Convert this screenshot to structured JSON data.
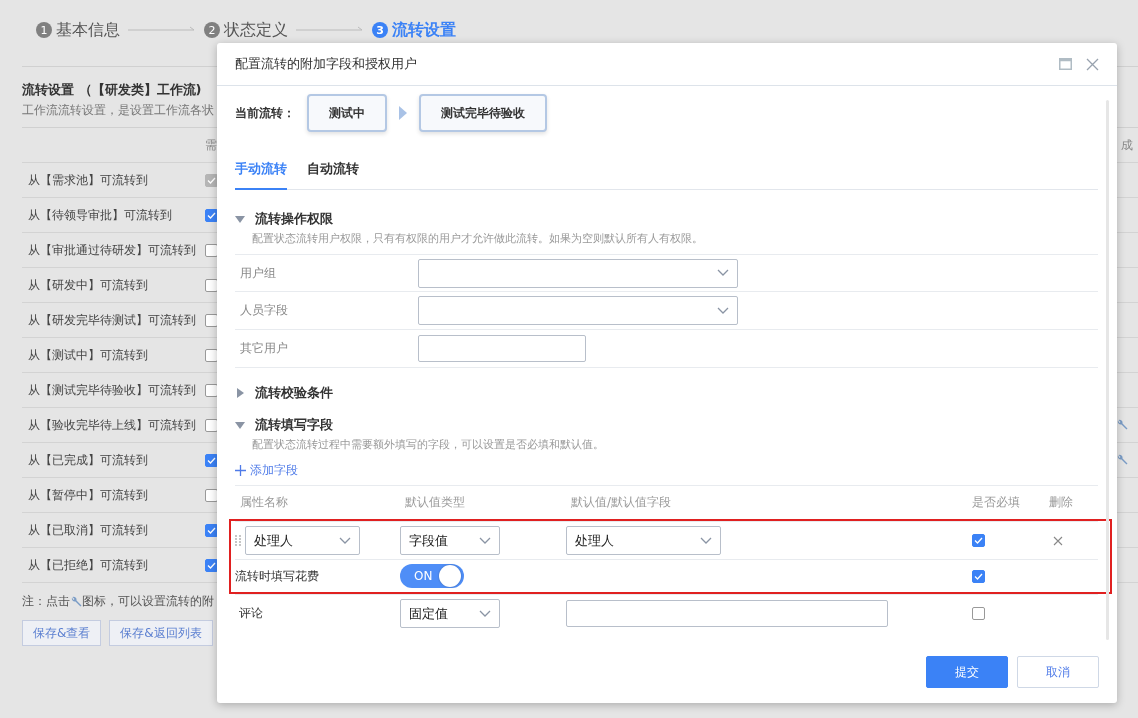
{
  "steps": [
    {
      "number": "1",
      "label": "基本信息",
      "selected": false
    },
    {
      "number": "2",
      "label": "状态定义",
      "selected": false
    },
    {
      "number": "3",
      "label": "流转设置",
      "selected": true
    }
  ],
  "page": {
    "title": "流转设置 （【研发类】工作流)",
    "description": "工作流流转设置，是设置工作流各状",
    "header_cells": [
      "需",
      "成"
    ],
    "rows": [
      {
        "label": "从【需求池】可流转到",
        "checked": true,
        "disabled": true,
        "tool": false
      },
      {
        "label": "从【待领导审批】可流转到",
        "checked": true,
        "disabled": false,
        "tool": false
      },
      {
        "label": "从【审批通过待研发】可流转到",
        "checked": false,
        "disabled": false,
        "tool": false
      },
      {
        "label": "从【研发中】可流转到",
        "checked": false,
        "disabled": false,
        "tool": false
      },
      {
        "label": "从【研发完毕待测试】可流转到",
        "checked": false,
        "disabled": false,
        "tool": false
      },
      {
        "label": "从【测试中】可流转到",
        "checked": false,
        "disabled": false,
        "tool": false
      },
      {
        "label": "从【测试完毕待验收】可流转到",
        "checked": false,
        "disabled": false,
        "tool": false
      },
      {
        "label": "从【验收完毕待上线】可流转到",
        "checked": false,
        "disabled": false,
        "tool": true
      },
      {
        "label": "从【已完成】可流转到",
        "checked": true,
        "disabled": false,
        "tool": true
      },
      {
        "label": "从【暂停中】可流转到",
        "checked": false,
        "disabled": false,
        "tool": false
      },
      {
        "label": "从【已取消】可流转到",
        "checked": true,
        "disabled": false,
        "tool": false
      },
      {
        "label": "从【已拒绝】可流转到",
        "checked": true,
        "disabled": false,
        "tool": false
      }
    ],
    "note_before": "注：点击",
    "note_after": "图标，可以设置流转的附",
    "buttons": [
      "保存&查看",
      "保存&返回列表"
    ]
  },
  "dialog": {
    "title": "配置流转的附加字段和授权用户",
    "current_flow": {
      "label": "当前流转：",
      "from": "测试中",
      "to": "测试完毕待验收"
    },
    "tabs": [
      {
        "label": "手动流转",
        "selected": true
      },
      {
        "label": "自动流转",
        "selected": false
      }
    ],
    "sections": [
      {
        "title": "流转操作权限",
        "expanded": true,
        "description": "配置状态流转用户权限，只有有权限的用户才允许做此流转。如果为空则默认所有人有权限。",
        "form": [
          {
            "label": "用户组",
            "kind": "select"
          },
          {
            "label": "人员字段",
            "kind": "select"
          },
          {
            "label": "其它用户",
            "kind": "input"
          }
        ]
      },
      {
        "title": "流转校验条件",
        "expanded": false
      },
      {
        "title": "流转填写字段",
        "expanded": true,
        "description": "配置状态流转过程中需要额外填写的字段，可以设置是否必填和默认值。",
        "add_link": "添加字段",
        "fields_table": {
          "columns": [
            "属性名称",
            "默认值类型",
            "默认值/默认值字段",
            "是否必填",
            "删除"
          ],
          "rows": [
            {
              "kind": "select",
              "name": "处理人",
              "type": "字段值",
              "value": "处理人",
              "required": true,
              "highlighted": true
            },
            {
              "kind": "switch",
              "name": "流转时填写花费",
              "switch_label": "ON",
              "on": true,
              "required": true,
              "highlighted": true
            },
            {
              "kind": "input",
              "name": "评论",
              "type": "固定值",
              "required": false,
              "highlighted": false
            }
          ]
        }
      }
    ],
    "buttons": [
      {
        "label": "提交",
        "kind": "primary"
      },
      {
        "label": "取消",
        "kind": "default"
      }
    ]
  }
}
